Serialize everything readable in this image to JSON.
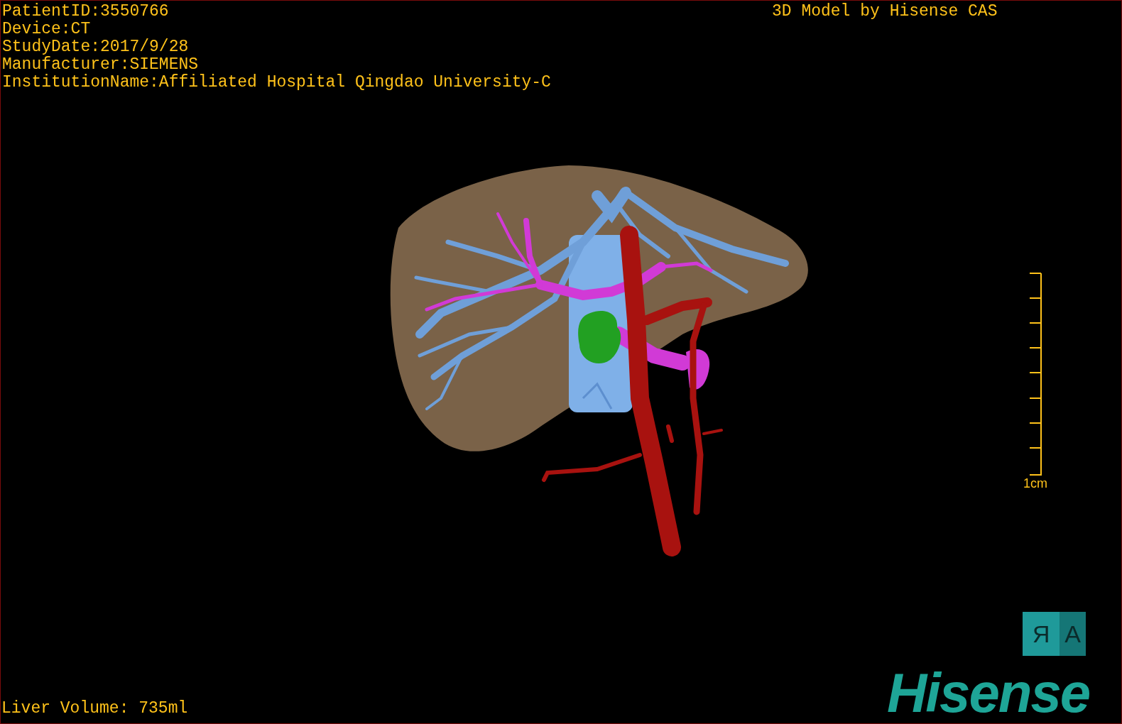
{
  "header_lines": [
    "PatientID:3550766",
    "Device:CT",
    "StudyDate:2017/9/28",
    "Manufacturer:SIEMENS",
    "InstitutionName:Affiliated Hospital Qingdao University-C"
  ],
  "title": "3D Model by Hisense CAS",
  "scale_bar": {
    "label": "1cm"
  },
  "orientation_cube": {
    "faces": [
      {
        "letter": "R",
        "mirrored": true
      },
      {
        "letter": "A",
        "mirrored": false
      }
    ]
  },
  "logo": "Hisense",
  "liver_volume": "Liver Volume: 735ml"
}
